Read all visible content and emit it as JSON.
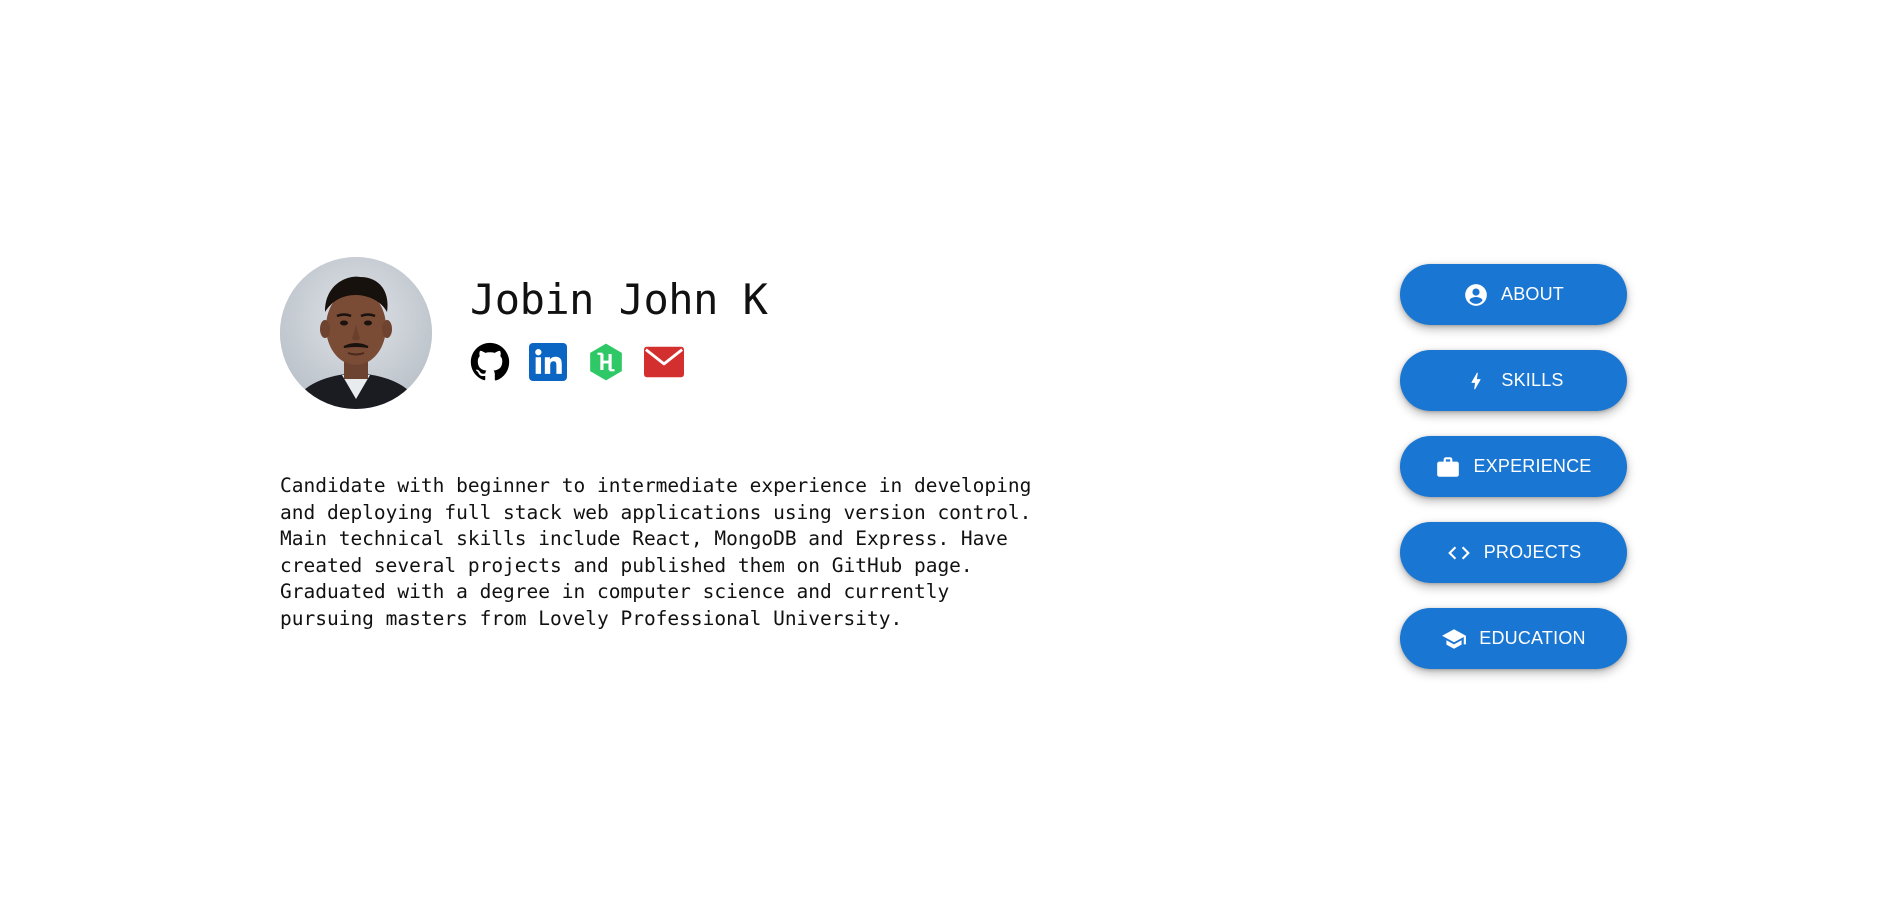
{
  "profile": {
    "name": "Jobin John K",
    "avatar_icon": "profile-photo",
    "social": [
      {
        "name": "github",
        "icon": "github-icon",
        "color": "#000000"
      },
      {
        "name": "linkedin",
        "icon": "linkedin-icon",
        "color": "#0a66c2"
      },
      {
        "name": "hackerrank",
        "icon": "hackerrank-icon",
        "color": "#2ec866"
      },
      {
        "name": "email",
        "icon": "mail-icon",
        "color": "#d32f2f"
      }
    ],
    "bio": "Candidate with beginner to intermediate experience in developing and deploying full stack web applications using version control. Main technical skills include React, MongoDB and Express. Have created several projects and published them on GitHub page. Graduated with a degree in computer science and currently pursuing masters from Lovely Professional University."
  },
  "nav": {
    "accent_color": "#1976d2",
    "items": [
      {
        "label": "ABOUT",
        "icon": "account-circle-icon"
      },
      {
        "label": "SKILLS",
        "icon": "bolt-icon"
      },
      {
        "label": "EXPERIENCE",
        "icon": "briefcase-icon"
      },
      {
        "label": "PROJECTS",
        "icon": "code-icon"
      },
      {
        "label": "EDUCATION",
        "icon": "graduation-cap-icon"
      }
    ]
  }
}
